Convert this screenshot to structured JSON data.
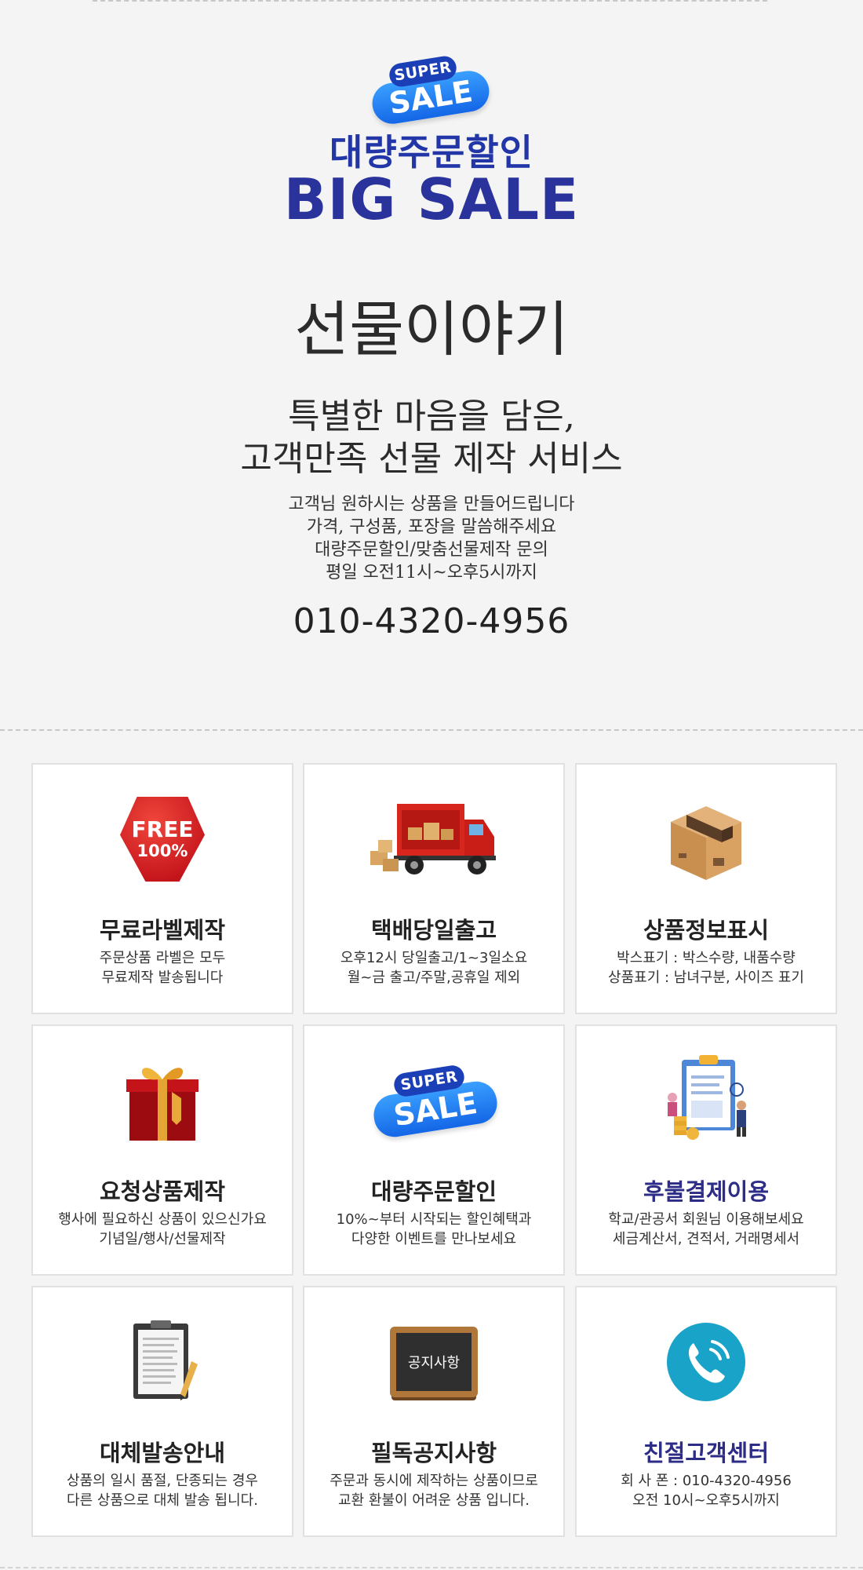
{
  "hero": {
    "badge_super": "SUPER",
    "badge_sale": "SALE",
    "subtitle": "대량주문할인",
    "big_title": "BIG SALE",
    "brand": "선물이야기",
    "tagline_line1": "특별한 마음을 담은,",
    "tagline_line2": "고객만족 선물 제작 서비스",
    "info_lines": [
      "고객님 원하시는 상품을 만들어드립니다",
      "가격, 구성품, 포장을 말씀해주세요",
      "대량주문할인/맞춤선물제작 문의",
      "평일 오전11시~오후5시까지"
    ],
    "phone": "010-4320-4956"
  },
  "cards": [
    {
      "title": "무료라벨제작",
      "desc": [
        "주문상품 라벨은 모두",
        "무료제작 발송됩니다"
      ],
      "icon": "free-100-badge-icon",
      "badge_line1": "FREE",
      "badge_line2": "100%"
    },
    {
      "title": "택배당일출고",
      "desc": [
        "오후12시 당일출고/1~3일소요",
        "월~금 출고/주말,공휴일 제외"
      ],
      "icon": "delivery-truck-icon"
    },
    {
      "title": "상품정보표시",
      "desc": [
        "박스표기 : 박스수량, 내품수량",
        "상품표기 : 남녀구분, 사이즈 표기"
      ],
      "icon": "cardboard-box-icon"
    },
    {
      "title": "요청상품제작",
      "desc": [
        "행사에 필요하신 상품이 있으신가요",
        "기념일/행사/선물제작"
      ],
      "icon": "gift-box-icon"
    },
    {
      "title": "대량주문할인",
      "desc": [
        "10%~부터 시작되는 할인혜택과",
        "다양한 이벤트를 만나보세요"
      ],
      "icon": "super-sale-icon",
      "badge_super": "SUPER",
      "badge_sale": "SALE"
    },
    {
      "title": "후불결제이용",
      "desc": [
        "학교/관공서 회원님 이용해보세요",
        "세금계산서, 견적서, 거래명세서"
      ],
      "icon": "clipboard-payment-icon"
    },
    {
      "title": "대체발송안내",
      "desc": [
        "상품의 일시 품절, 단종되는 경우",
        "다른 상품으로 대체 발송 됩니다."
      ],
      "icon": "clipboard-pencil-icon"
    },
    {
      "title": "필독공지사항",
      "desc": [
        "주문과 동시에 제작하는 상품이므로",
        "교환 환불이 어려운 상품 입니다."
      ],
      "icon": "notice-board-icon",
      "board_text": "공지사항"
    },
    {
      "title": "친절고객센터",
      "desc": [
        "회 사 폰 : 010-4320-4956",
        "오전 10시~오후5시까지"
      ],
      "icon": "phone-icon"
    }
  ],
  "colors": {
    "hero_navy": "#2236a8",
    "title_navy": "#2d2c86",
    "sale_blue": "#1466e6",
    "free_red": "#c2121a"
  }
}
